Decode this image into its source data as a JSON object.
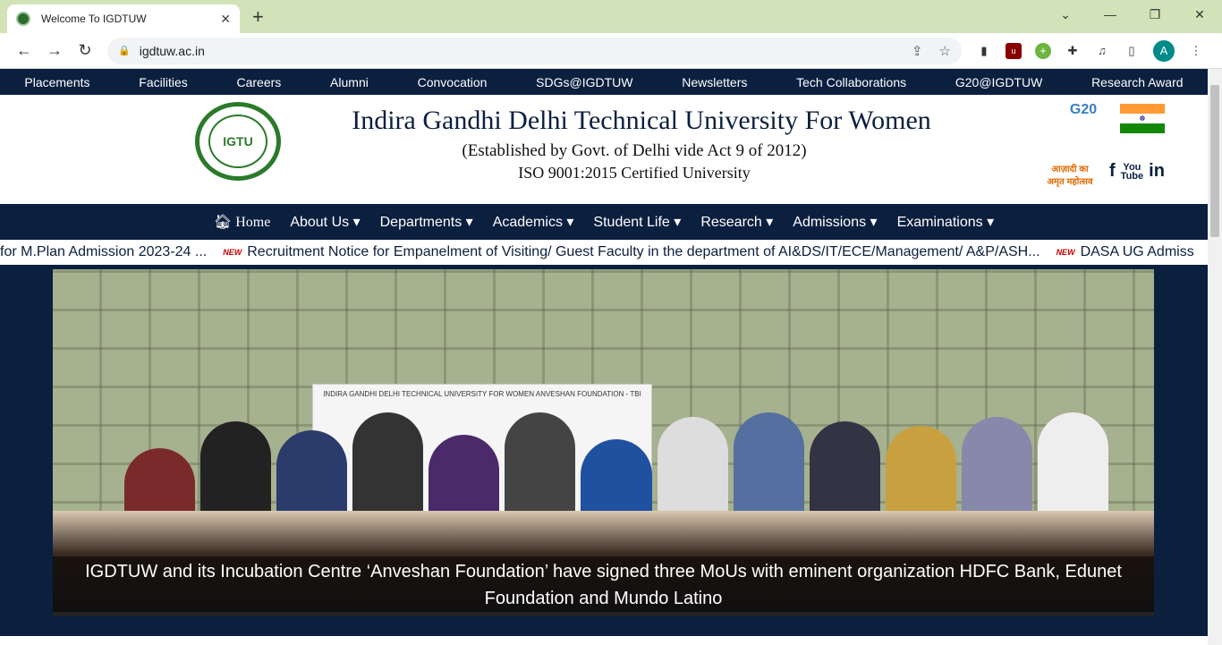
{
  "browser": {
    "tab_title": "Welcome To IGDTUW",
    "url": "igdtuw.ac.in",
    "avatar_letter": "A"
  },
  "top_nav": [
    "Placements",
    "Facilities",
    "Careers",
    "Alumni",
    "Convocation",
    "SDGs@IGDTUW",
    "Newsletters",
    "Tech Collaborations",
    "G20@IGDTUW",
    "Research Award"
  ],
  "header": {
    "university_name": "Indira Gandhi Delhi Technical University For Women",
    "established": "(Established by Govt. of Delhi vide Act 9 of 2012)",
    "iso": "ISO 9001:2015 Certified University",
    "logo_text": "IGTU",
    "g20": "G20",
    "azadi": "आज़ादी का अमृत महोत्सव"
  },
  "main_nav": {
    "home": "Home",
    "items": [
      "About Us",
      "Departments",
      "Academics",
      "Student Life",
      "Research",
      "Admissions",
      "Examinations"
    ]
  },
  "ticker": {
    "items": [
      "for M.Plan Admission 2023-24 ...",
      "Recruitment Notice for Empanelment of Visiting/ Guest Faculty in the department of AI&DS/IT/ECE/Management/ A&P/ASH...",
      "DASA UG Admiss"
    ],
    "badge": "NEW"
  },
  "hero": {
    "banner_text": "INDIRA GANDHI DELHI TECHNICAL UNIVERSITY FOR WOMEN ANVESHAN FOUNDATION - TBI",
    "caption": "IGDTUW and its Incubation Centre ‘Anveshan Foundation’ have signed three MoUs with eminent organization HDFC Bank, Edunet Foundation and Mundo Latino"
  }
}
